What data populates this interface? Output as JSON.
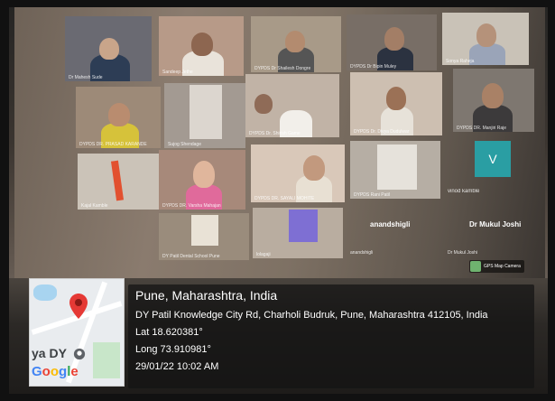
{
  "tiles": [
    {
      "name": "Dr Mahesh Sude"
    },
    {
      "name": "Sandeep Jethe"
    },
    {
      "name": "DYPDS Dr Shailesh Dongre"
    },
    {
      "name": "DYPDS Dr Bipin Muley"
    },
    {
      "name": "Sonya Raheja"
    },
    {
      "name": "DYPDS DR. PRASAD KARANDE"
    },
    {
      "name": "Sujog Shendage"
    },
    {
      "name": "DYPDS Dr. Shirish Game"
    },
    {
      "name": "DYPDS Dr. Divya Dudulwar"
    },
    {
      "name": "DYPDS DR. Manjiri Raje"
    },
    {
      "name": "Kajal Kamble"
    },
    {
      "name": "DYPDS DR. Varsha Mahajan"
    },
    {
      "name": "DYPDS DR. SAYALI MOHITE"
    },
    {
      "name": "DYPDS Rani Patil"
    },
    {
      "name": "vinod kamble"
    },
    {
      "name": "DY Patil Dental School Pune"
    },
    {
      "name": "lolagaji"
    },
    {
      "name": "anandshigli"
    },
    {
      "name": "Dr Mukul Joshi"
    }
  ],
  "avatar_letter": "V",
  "name_cards": {
    "left": "anandshigli",
    "right": "Dr Mukul Joshi"
  },
  "gps_badge": "GPS Map Camera",
  "map": {
    "label": "ya DY",
    "google": "Google"
  },
  "geo": {
    "place": "Pune, Maharashtra, India",
    "address": "DY Patil Knowledge City Rd, Charholi Budruk, Pune, Maharashtra 412105, India",
    "lat": "Lat 18.620381°",
    "long": "Long 73.910981°",
    "datetime": "29/01/22 10:02 AM"
  },
  "colors": {
    "avatar_bg": "#2a9ea3",
    "pin": "#e53935"
  }
}
